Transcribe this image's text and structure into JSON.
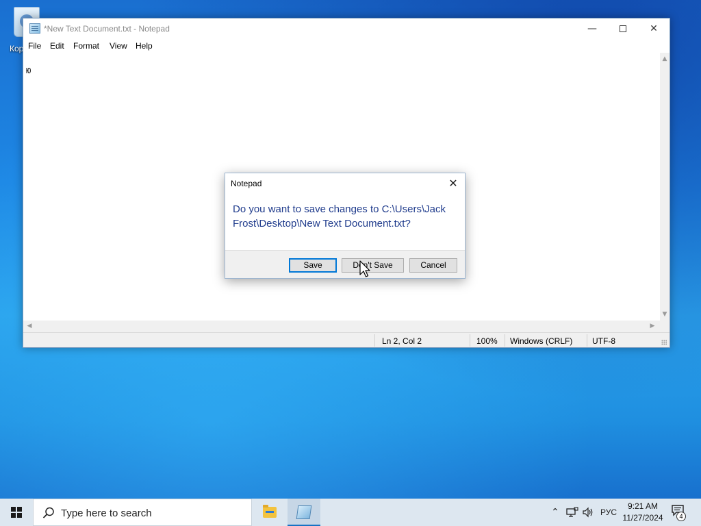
{
  "desktop": {
    "recycle_label": "Кор"
  },
  "notepad": {
    "title": "*New Text Document.txt - Notepad",
    "menu": [
      "File",
      "Edit",
      "Format",
      "View",
      "Help"
    ],
    "content": "Ю",
    "status": {
      "position": "Ln 2, Col 2",
      "zoom": "100%",
      "line_ending": "Windows (CRLF)",
      "encoding": "UTF-8"
    }
  },
  "dialog": {
    "title": "Notepad",
    "message": "Do you want to save changes to C:\\Users\\Jack Frost\\Desktop\\New Text Document.txt?",
    "buttons": {
      "save": "Save",
      "dont_save": "Don't Save",
      "cancel": "Cancel"
    }
  },
  "taskbar": {
    "search_placeholder": "Type here to search",
    "language": "РУС",
    "time": "9:21 AM",
    "date": "11/27/2024",
    "notification_count": "4"
  },
  "colors": {
    "accent": "#0078d7",
    "dialog_message": "#1f3b8c",
    "taskbar": "#dde7f0"
  },
  "icons": [
    "recycle-bin-icon",
    "notepad-icon",
    "search-icon",
    "folder-icon",
    "windows-logo-icon",
    "network-icon",
    "volume-icon",
    "notification-icon"
  ]
}
